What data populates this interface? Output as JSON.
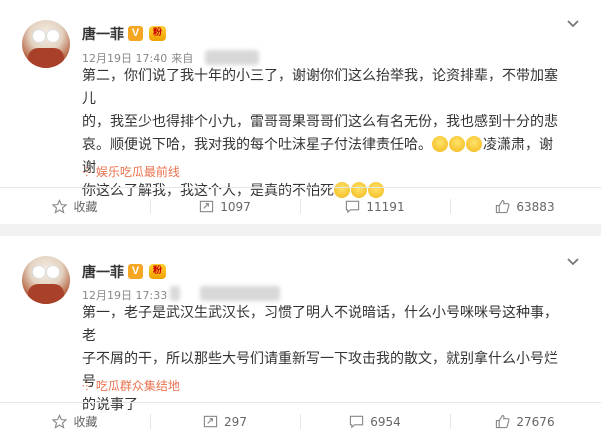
{
  "posts": [
    {
      "author": "唐一菲",
      "verified_badge": "V",
      "fan_badge": "粉",
      "time": "12月19日 17:40",
      "source_prefix": "来自",
      "text_lines": [
        "第二，你们说了我十年的小三了，谢谢你们这么抬举我，论资排辈，不带加塞儿",
        "的，我至少也得排个小九，雷哥哥果哥哥们这么有名无份，我也感到十分的悲",
        "哀。顺便说下哈，我对我的每个吐沫星子付法律责任哈。",
        "凌潇肃，谢谢",
        "你这么了解我，我这个人，是真的不怕死"
      ],
      "topic": "娱乐吃瓜最前线",
      "actions": {
        "favorite": "收藏",
        "repost": "1097",
        "comment": "11191",
        "like": "63883"
      }
    },
    {
      "author": "唐一菲",
      "verified_badge": "V",
      "fan_badge": "粉",
      "time": "12月19日 17:33",
      "text_lines": [
        "第一，老子是武汉生武汉长，习惯了明人不说暗话，什么小号咪咪号这种事，老",
        "子不屑的干，所以那些大号们请重新写一下攻击我的散文，就别拿什么小号烂号",
        "的说事了"
      ],
      "topic": "吃瓜群众集结地",
      "actions": {
        "favorite": "收藏",
        "repost": "297",
        "comment": "6954",
        "like": "27676"
      }
    }
  ],
  "colors": {
    "topic": "#eb7350",
    "badge": "#f5a623",
    "meta": "#888888"
  },
  "icons": [
    "avatar",
    "verified-icon",
    "fan-badge-icon",
    "chevron-down-icon",
    "topic-icon",
    "star-icon",
    "repost-icon",
    "comment-icon",
    "like-icon",
    "laughing-emoji-icon",
    "crying-emoji-icon"
  ]
}
